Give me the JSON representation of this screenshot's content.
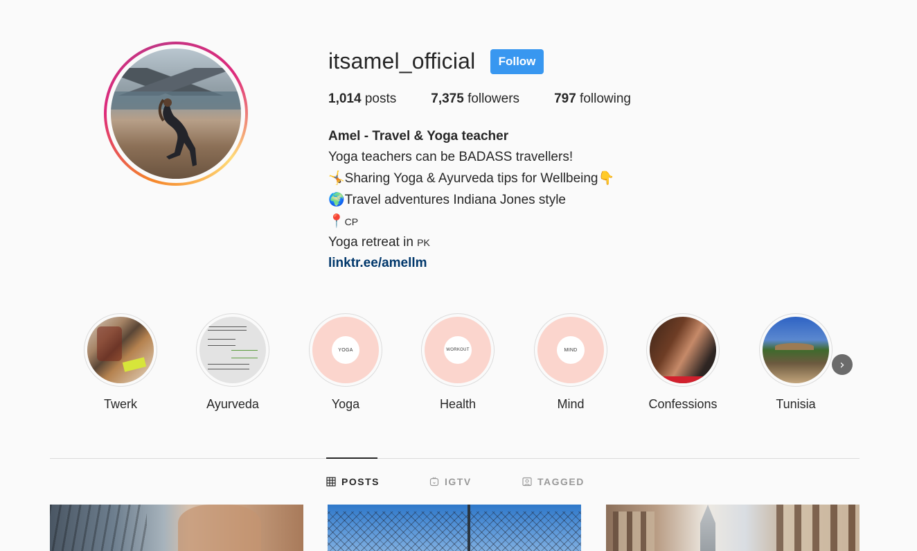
{
  "profile": {
    "username": "itsamel_official",
    "follow_label": "Follow",
    "stats": {
      "posts_count": "1,014",
      "posts_label": "posts",
      "followers_count": "7,375",
      "followers_label": "followers",
      "following_count": "797",
      "following_label": "following"
    },
    "bio": {
      "name": "Amel - Travel & Yoga teacher",
      "line1": "Yoga teachers can be BADASS travellers!",
      "line2_icon": "🤸",
      "line2": "Sharing Yoga & Ayurveda tips for Wellbeing",
      "line2_end_icon": "👇",
      "line3_icon": "🌍",
      "line3": "Travel adventures Indiana Jones style",
      "line4_icon": "📍",
      "line4": "CP",
      "line5": "Yoga retreat in",
      "line5_suffix": "PK",
      "link": "linktr.ee/amellm"
    }
  },
  "highlights": [
    {
      "label": "Twerk",
      "icon": "photo"
    },
    {
      "label": "Ayurveda",
      "icon": "text-card"
    },
    {
      "label": "Yoga",
      "inner_text": "YOGA"
    },
    {
      "label": "Health",
      "inner_text": "WORKOUT"
    },
    {
      "label": "Mind",
      "inner_text": "MIND"
    },
    {
      "label": "Confessions",
      "icon": "photo"
    },
    {
      "label": "Tunisia",
      "icon": "photo"
    }
  ],
  "next_icon": "›",
  "tabs": [
    {
      "label": "POSTS",
      "icon": "grid-icon",
      "active": true
    },
    {
      "label": "IGTV",
      "icon": "igtv-icon",
      "active": false
    },
    {
      "label": "TAGGED",
      "icon": "tagged-icon",
      "active": false
    }
  ],
  "colors": {
    "follow_button": "#3897f0",
    "link": "#00376b",
    "highlight_pink": "#fbd5cd"
  }
}
